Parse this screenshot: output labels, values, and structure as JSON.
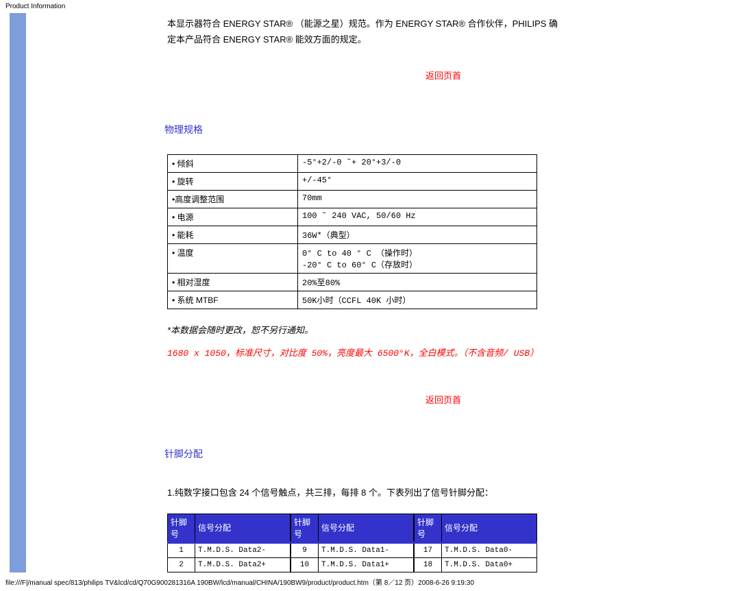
{
  "header": "Product Information",
  "intro": {
    "line1": "本显示器符合 ENERGY STAR® （能源之星）规范。作为 ENERGY STAR® 合作伙伴，PHILIPS 确",
    "line2": "定本产品符合 ENERGY STAR® 能效方面的规定。"
  },
  "links": {
    "return_top": "返回页首"
  },
  "phys": {
    "heading": "物理规格",
    "rows": [
      {
        "label": "• 倾斜",
        "value": "-5°+2/-0 ˜+ 20°+3/-0"
      },
      {
        "label": "• 旋转",
        "value": "+/-45°"
      },
      {
        "label": "•高度调整范围",
        "value": "70mm"
      },
      {
        "label": "• 电源",
        "value": "100 ˜ 240 VAC, 50/60 Hz"
      },
      {
        "label": "• 能耗",
        "value": "36W*（典型）"
      },
      {
        "label": "• 温度",
        "value": "0° C to 40 ° C （操作时）\n-20° C to 60° C（存放时）"
      },
      {
        "label": "• 相对湿度",
        "value": "20%至80%"
      },
      {
        "label": "• 系统 MTBF",
        "value": "50K小时（CCFL 40K 小时）"
      }
    ],
    "note": "*本数据会随时更改，恕不另行通知。",
    "condition": "1680 x 1050，标准尺寸，对比度 50%，亮度最大 6500°K，全白模式。（不含音频/ USB）"
  },
  "pins": {
    "heading": "针脚分配",
    "intro": "1.纯数字接口包含 24 个信号触点，共三排，每排 8 个。下表列出了信号针脚分配：",
    "col_headers": {
      "pin": "针脚号",
      "signal": "信号分配"
    },
    "group1": [
      {
        "pin": "1",
        "signal": "T.M.D.S. Data2-"
      },
      {
        "pin": "2",
        "signal": "T.M.D.S. Data2+"
      }
    ],
    "group2": [
      {
        "pin": "9",
        "signal": "T.M.D.S. Data1-"
      },
      {
        "pin": "10",
        "signal": "T.M.D.S. Data1+"
      }
    ],
    "group3": [
      {
        "pin": "17",
        "signal": "T.M.D.S. Data0-"
      },
      {
        "pin": "18",
        "signal": "T.M.D.S. Data0+"
      }
    ]
  },
  "footer": "file:///F|/manual spec/813/philips TV&lcd/cd/Q70G900281316A 190BW/lcd/manual/CHINA/190BW9/product/product.htm（第 8／12 页）2008-6-26 9:19:30"
}
